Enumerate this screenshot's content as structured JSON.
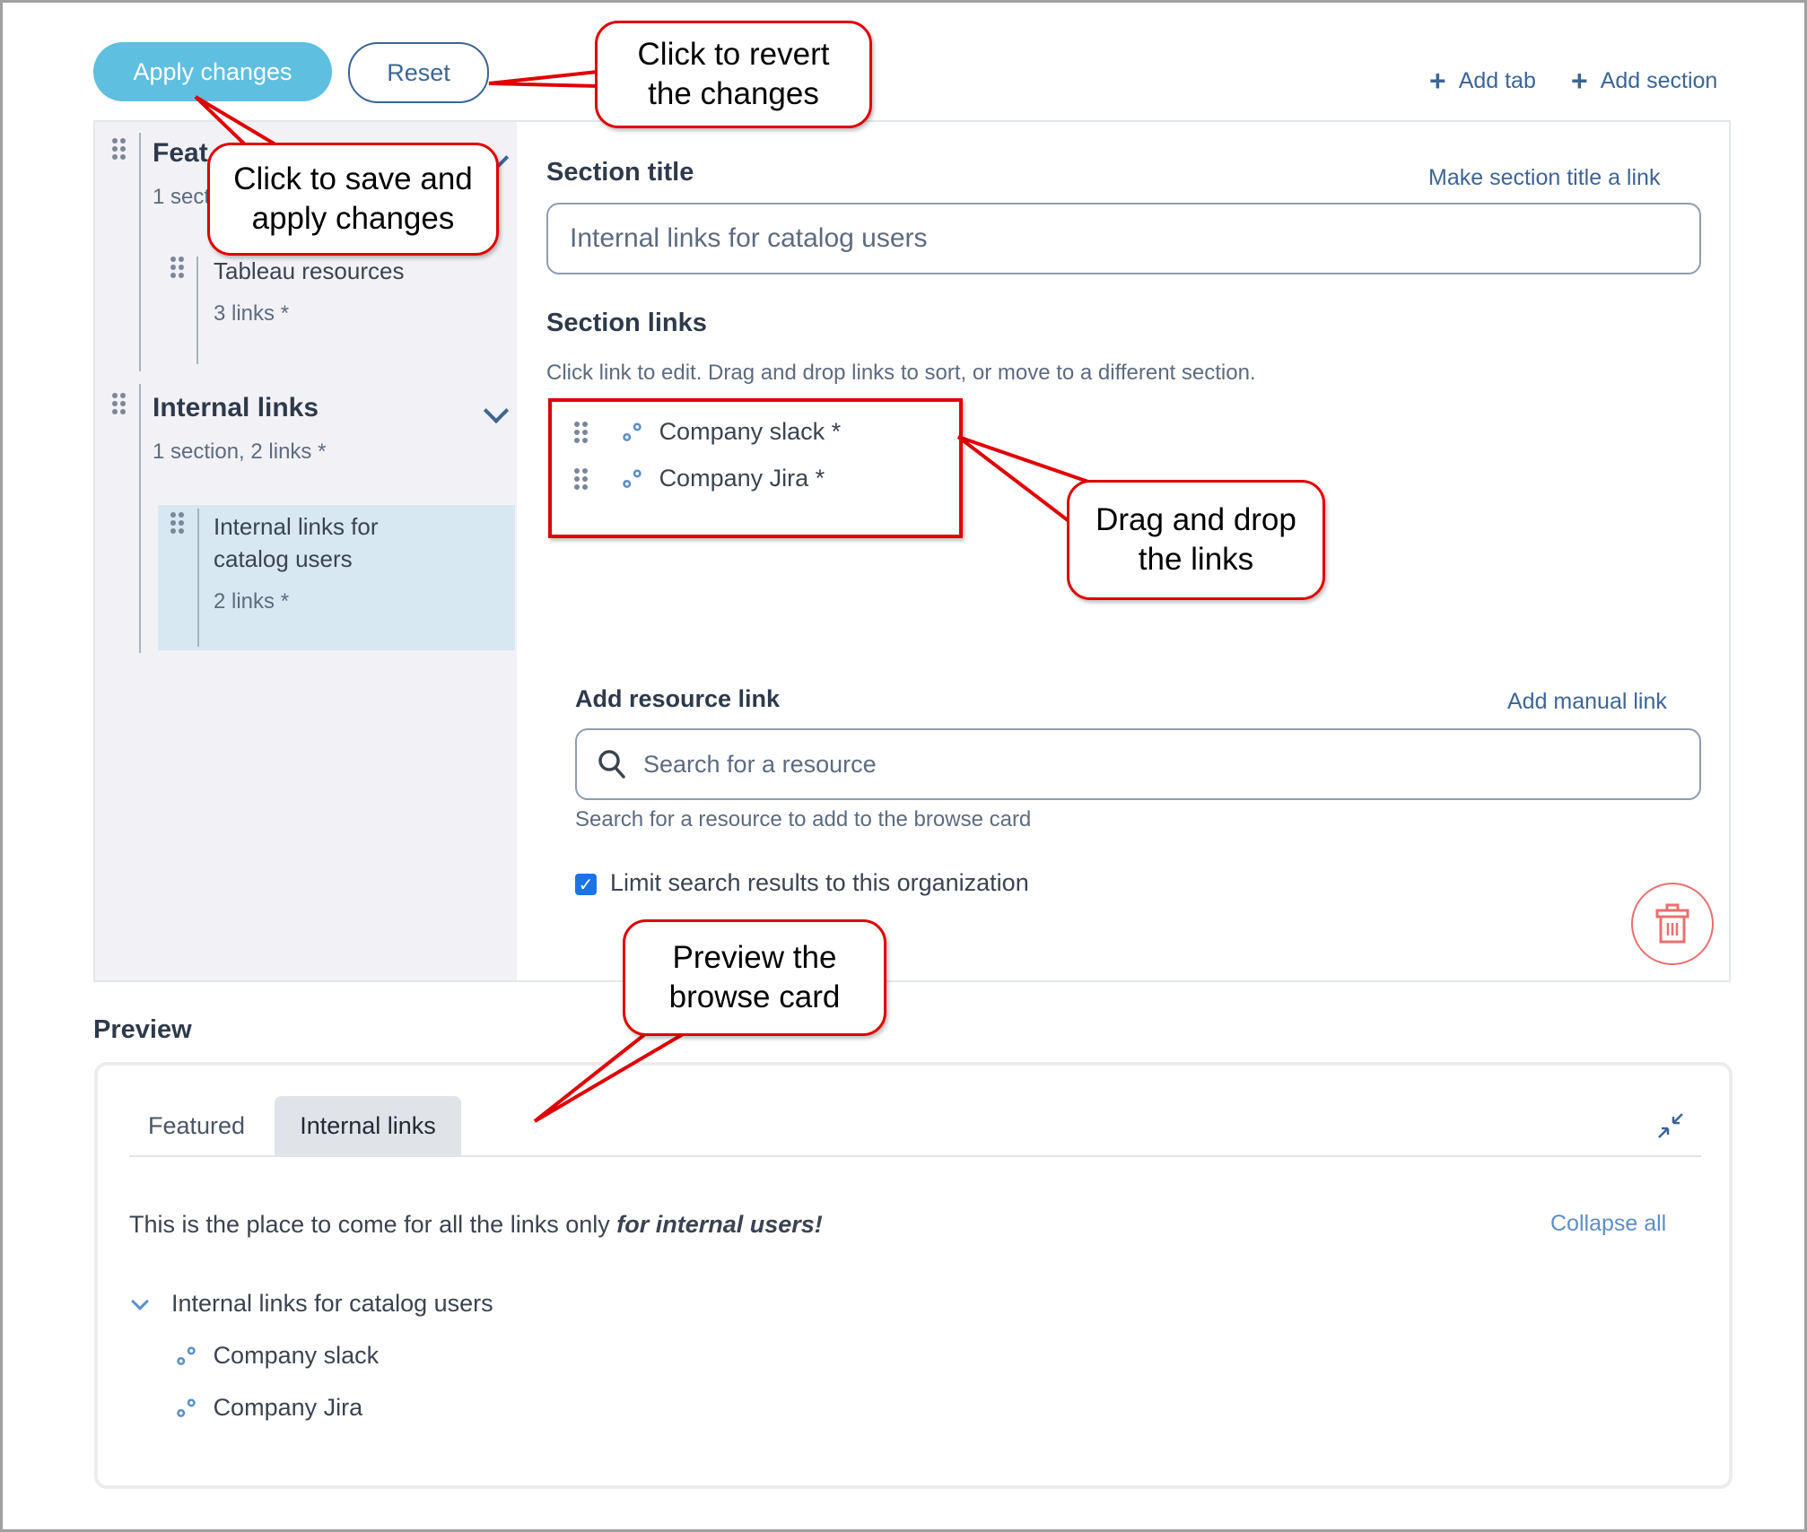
{
  "toolbar": {
    "apply_label": "Apply changes",
    "reset_label": "Reset",
    "add_tab_label": "Add tab",
    "add_section_label": "Add section",
    "add_icon": "plus-icon"
  },
  "sidebar": {
    "tabs": [
      {
        "title": "Featured",
        "title_visible": "Feat",
        "summary": "1 section, 3 links *",
        "summary_visible": "1 sect",
        "sections": [
          {
            "title": "Tableau resources",
            "count": "3 links *"
          }
        ]
      },
      {
        "title": "Internal links",
        "summary": "1 section, 2 links *",
        "sections": [
          {
            "title_line1": "Internal links for",
            "title_line2": "catalog users",
            "count": "2 links *",
            "selected": true
          }
        ]
      }
    ]
  },
  "editor": {
    "section_title_label": "Section title",
    "make_link_label": "Make section title a link",
    "section_title_value": "Internal links for catalog users",
    "section_links_label": "Section links",
    "section_links_help": "Click link to edit. Drag and drop links to sort, or move to a different section.",
    "links": [
      {
        "label": "Company slack *",
        "icon": "link-icon"
      },
      {
        "label": "Company Jira *",
        "icon": "link-icon"
      }
    ],
    "add_resource_label": "Add resource link",
    "add_manual_label": "Add manual link",
    "search_placeholder": "Search for a resource",
    "search_help": "Search for a resource to add to the browse card",
    "limit_label": "Limit search results to this organization",
    "limit_checked": true
  },
  "preview": {
    "heading": "Preview",
    "tabs": [
      {
        "label": "Featured",
        "active": false
      },
      {
        "label": "Internal links",
        "active": true
      }
    ],
    "description_plain": "This is the place to come for all the links only ",
    "description_emphasis": "for internal users!",
    "collapse_all_label": "Collapse all",
    "section_title": "Internal links for catalog users",
    "links": [
      "Company slack",
      "Company Jira"
    ]
  },
  "callouts": {
    "revert": [
      "Click to revert",
      "the changes"
    ],
    "save": [
      "Click to save and",
      "apply changes"
    ],
    "drag": [
      "Drag and drop",
      "the links"
    ],
    "preview": [
      "Preview the",
      "browse card"
    ]
  },
  "colors": {
    "accent": "#3d6596",
    "apply_button": "#5fbfe0",
    "selected_section": "#d8e8f2",
    "callout_border": "#e00000",
    "danger": "#e9706f",
    "link_icon": "#5b8fc9"
  }
}
